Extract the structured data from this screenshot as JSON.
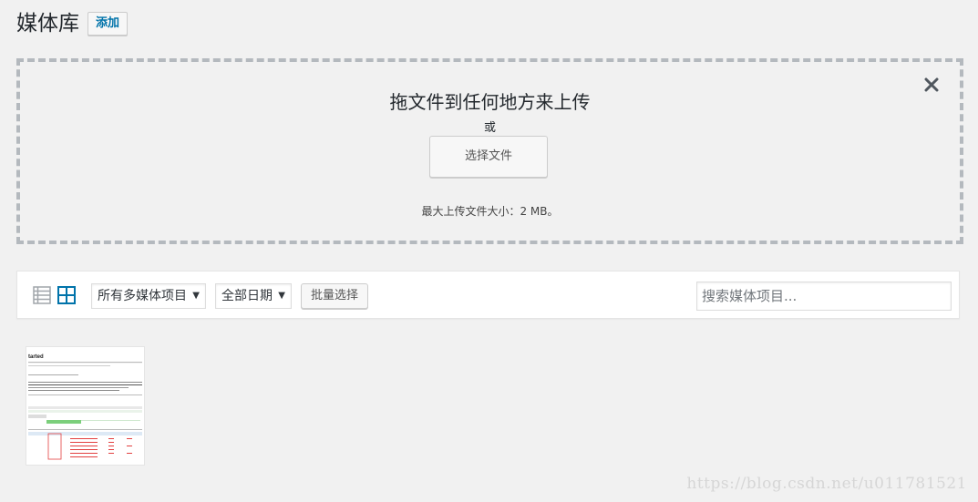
{
  "header": {
    "title": "媒体库",
    "add_label": "添加"
  },
  "uploader": {
    "drop_text": "拖文件到任何地方来上传",
    "or_text": "或",
    "select_files_label": "选择文件",
    "max_size_text": "最大上传文件大小：2 MB。",
    "close_icon": "close-icon"
  },
  "toolbar": {
    "media_type_selected": "所有多媒体项目",
    "date_selected": "全部日期",
    "bulk_select_label": "批量选择",
    "search_placeholder": "搜索媒体项目...",
    "list_view_icon": "list-view-icon",
    "grid_view_icon": "grid-view-icon"
  },
  "attachments": [
    {
      "thumbnail_title": "tarted"
    }
  ],
  "watermark": "https://blog.csdn.net/u011781521",
  "colors": {
    "background": "#f1f1f1",
    "accent": "#0073aa",
    "dashed_border": "#b4b9be"
  }
}
